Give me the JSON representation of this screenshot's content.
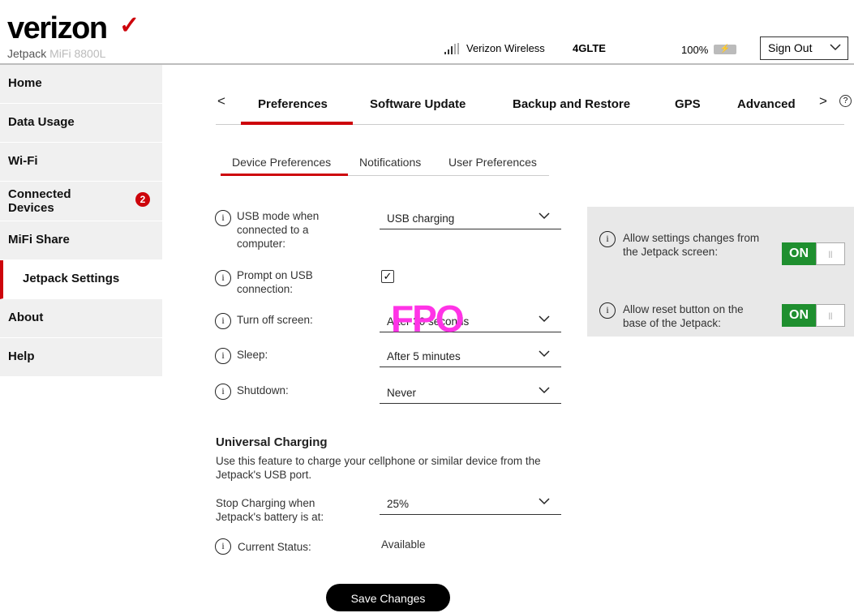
{
  "header": {
    "logo": "verizon",
    "logo_mark": "✓",
    "product": "Jetpack",
    "model": "MiFi 8800L",
    "carrier": "Verizon Wireless",
    "network": "4GLTE",
    "battery": "100%",
    "battery_icon": "charging-battery-icon",
    "signout": "Sign Out"
  },
  "sidebar": {
    "items": [
      {
        "label": "Home"
      },
      {
        "label": "Data Usage"
      },
      {
        "label": "Wi-Fi"
      },
      {
        "label": "Connected Devices",
        "badge": "2"
      },
      {
        "label": "MiFi Share"
      },
      {
        "label": "Jetpack Settings",
        "active": true
      },
      {
        "label": "About"
      },
      {
        "label": "Help"
      }
    ]
  },
  "tabs": {
    "prev": "<",
    "next": ">",
    "help": "?",
    "items": [
      "Preferences",
      "Software Update",
      "Backup and Restore",
      "GPS",
      "Advanced"
    ],
    "active": "Preferences"
  },
  "subtabs": {
    "items": [
      "Device Preferences",
      "Notifications",
      "User Preferences"
    ],
    "active": "Device Preferences"
  },
  "form": {
    "usb_mode": {
      "label": "USB mode when connected to a computer:",
      "value": "USB charging"
    },
    "prompt_usb": {
      "label": "Prompt on USB connection:",
      "checked": true
    },
    "turn_off_screen": {
      "label": "Turn off screen:",
      "value": "After 30 seconds"
    },
    "sleep": {
      "label": "Sleep:",
      "value": "After 5 minutes"
    },
    "shutdown": {
      "label": "Shutdown:",
      "value": "Never"
    },
    "fpo": "FPO"
  },
  "universal_charging": {
    "title": "Universal Charging",
    "description": "Use this feature to charge your cellphone or similar device from the Jetpack's USB port.",
    "stop_label": "Stop Charging when Jetpack's battery is at:",
    "stop_value": "25%",
    "status_label": "Current Status:",
    "status_value": "Available"
  },
  "panel": {
    "allow_settings": {
      "label": "Allow settings changes from the Jetpack screen:",
      "state": "ON"
    },
    "allow_reset": {
      "label": "Allow reset button on the base of the Jetpack:",
      "state": "ON"
    }
  },
  "save_label": "Save Changes",
  "colors": {
    "accent": "#cd040b",
    "toggle_on": "#1f8f2f",
    "fpo": "#ff33e6"
  }
}
